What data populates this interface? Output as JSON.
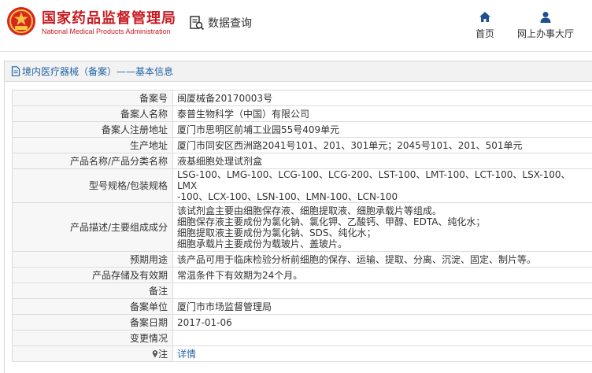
{
  "header": {
    "org_name_cn": "国家药品监督管理局",
    "org_name_en": "National Medical Products Administration",
    "query_label": "数据查询",
    "nav": [
      {
        "label": "首页",
        "icon": "home-icon"
      },
      {
        "label": "网上办事大厅",
        "icon": "user-icon"
      }
    ]
  },
  "panel": {
    "title": "境内医疗器械（备案）——基本信息"
  },
  "colors": {
    "brand_red": "#c81b20",
    "link_blue": "#2365a6",
    "nav_icon_blue": "#1f4f8f"
  },
  "rows": [
    {
      "label": "备案号",
      "value": "闽厦械备20170003号"
    },
    {
      "label": "备案人名称",
      "value": "泰普生物科学（中国）有限公司"
    },
    {
      "label": "备案人注册地址",
      "value": "厦门市思明区前埔工业园55号409单元"
    },
    {
      "label": "生产地址",
      "value": "厦门市同安区西洲路2041号101、201、301单元；2045号101、201、501单元"
    },
    {
      "label": "产品名称/产品分类名称",
      "value": "液基细胞处理试剂盒"
    },
    {
      "label": "型号规格/包装规格",
      "lines": [
        "LSG-100、LMG-100、LCG-100、LCG-200、LST-100、LMT-100、LCT-100、LSX-100、LMX",
        "-100、LCX-100、LSN-100、LMN-100、LCN-100"
      ]
    },
    {
      "label": "产品描述/主要组成成分",
      "lines": [
        "该试剂盒主要由细胞保存液、细胞提取液、细胞承载片等组成。",
        "细胞保存液主要成份为氯化钠、氯化钾、乙酸钙、甲醇、EDTA、纯化水；",
        "细胞提取液主要成份为氯化钠、SDS、纯化水；",
        "细胞承载片主要成份为载玻片、盖玻片。"
      ]
    },
    {
      "label": "预期用途",
      "value": "该产品可用于临床检验分析前细胞的保存、运输、提取、分离、沉淀、固定、制片等。"
    },
    {
      "label": "产品存储及有效期",
      "value": "常温条件下有效期为24个月。"
    },
    {
      "label": "备注",
      "value": ""
    },
    {
      "label": "备案单位",
      "value": "厦门市市场监督管理局"
    },
    {
      "label": "备案日期",
      "value": "2017-01-06"
    },
    {
      "label": "变更情况",
      "value": ""
    },
    {
      "label": "注",
      "icon": "pin-icon",
      "link": "详情"
    }
  ]
}
